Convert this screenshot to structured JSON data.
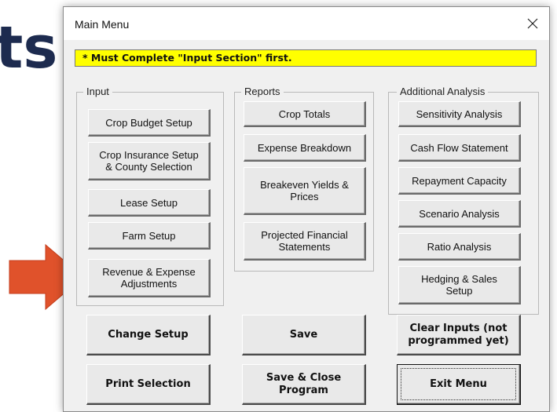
{
  "background": {
    "headline_fragment": "ts"
  },
  "window": {
    "title": "Main Menu",
    "close_icon": "close-icon"
  },
  "notice": {
    "text": "* Must Complete \"Input Section\" first.",
    "background_color": "#ffff00"
  },
  "input_section": {
    "legend": "Input",
    "buttons": [
      "Crop Budget Setup",
      "Crop Insurance Setup\n& County Selection",
      "Lease Setup",
      "Farm Setup",
      "Revenue & Expense\nAdjustments"
    ]
  },
  "reports_section": {
    "legend": "Reports",
    "buttons": [
      "Crop Totals",
      "Expense Breakdown",
      "Breakeven Yields &\nPrices",
      "Projected Financial\nStatements"
    ]
  },
  "analysis_section": {
    "legend": "Additional Analysis",
    "buttons": [
      "Sensitivity Analysis",
      "Cash Flow Statement",
      "Repayment Capacity",
      "Scenario Analysis",
      "Ratio Analysis",
      "Hedging & Sales\nSetup"
    ]
  },
  "actions": {
    "change_setup": "Change Setup",
    "save": "Save",
    "clear_inputs": "Clear Inputs (not\nprogrammed yet)",
    "print_selection": "Print Selection",
    "save_close": "Save & Close\nProgram",
    "exit_menu": "Exit Menu"
  },
  "annotation": {
    "arrow_color": "#e0522b",
    "arrow_icon": "right-arrow-icon"
  }
}
